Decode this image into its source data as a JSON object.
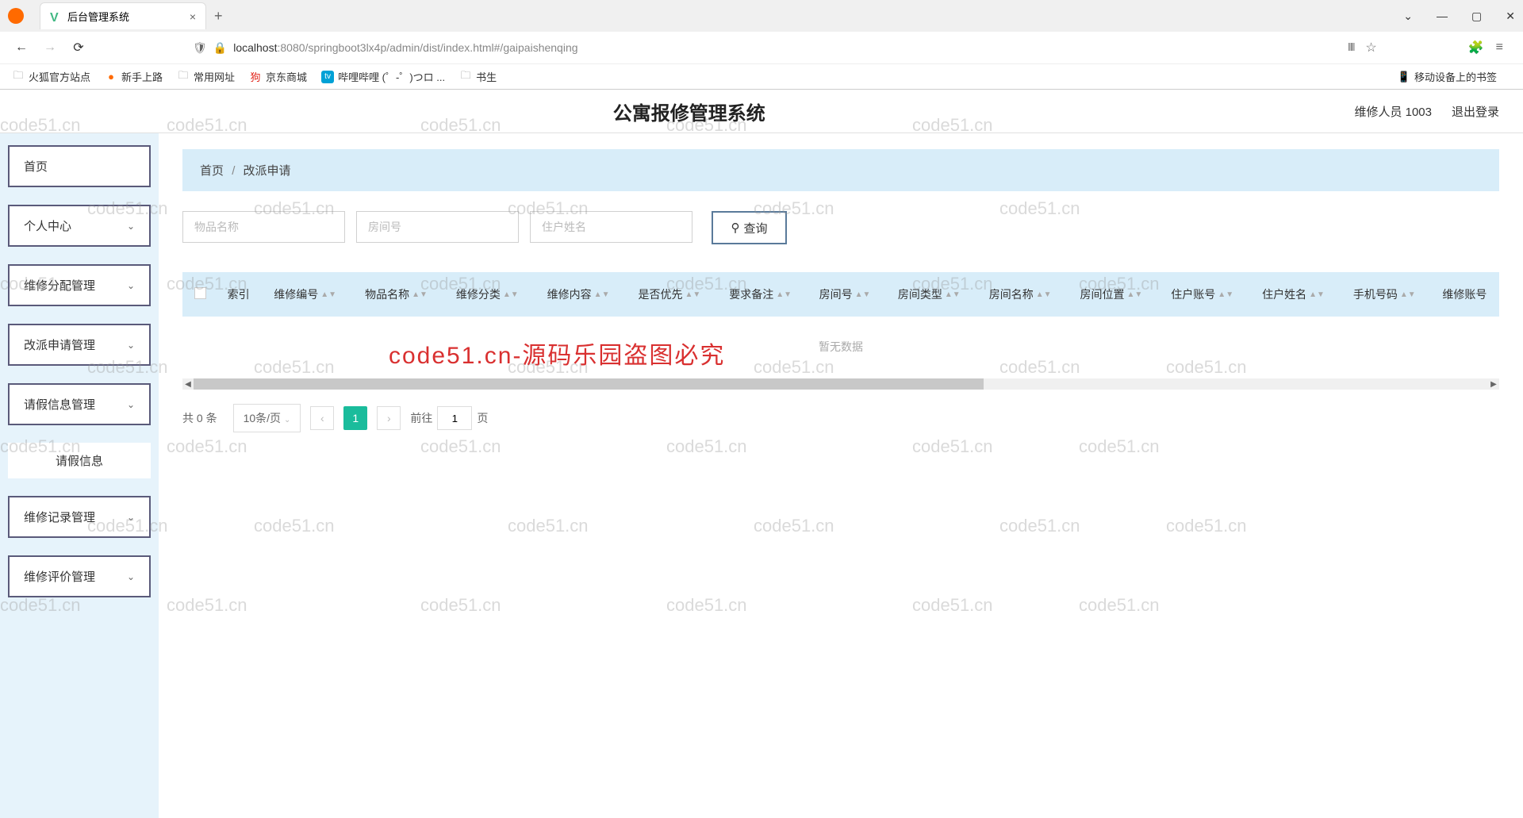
{
  "browser": {
    "tab_title": "后台管理系统",
    "url_host": "localhost",
    "url_path": ":8080/springboot3lx4p/admin/dist/index.html#/gaipaishenqing",
    "window_min": "—",
    "window_max": "▢",
    "window_close": "✕",
    "window_down": "⌄",
    "new_tab": "+",
    "tab_close": "×",
    "nav_back": "←",
    "nav_fwd": "→",
    "nav_reload": "⟳"
  },
  "bookmarks": {
    "b1": "火狐官方站点",
    "b2": "新手上路",
    "b3": "常用网址",
    "b4": "京东商城",
    "b5": "哔哩哔哩 (゜-゜)つロ ...",
    "b6": "书生",
    "right": "移动设备上的书签"
  },
  "header": {
    "title": "公寓报修管理系统",
    "user": "维修人员 1003",
    "logout": "退出登录"
  },
  "sidebar": {
    "m1": "首页",
    "m2": "个人中心",
    "m3": "维修分配管理",
    "m4": "改派申请管理",
    "m5": "请假信息管理",
    "m5_sub": "请假信息",
    "m6": "维修记录管理",
    "m7": "维修评价管理"
  },
  "breadcrumb": {
    "home": "首页",
    "sep": "/",
    "current": "改派申请"
  },
  "search": {
    "ph1": "物品名称",
    "ph2": "房间号",
    "ph3": "住户姓名",
    "btn": "查询"
  },
  "table": {
    "h1": "索引",
    "h2": "维修编号",
    "h3": "物品名称",
    "h4": "维修分类",
    "h5": "维修内容",
    "h6": "是否优先",
    "h7": "要求备注",
    "h8": "房间号",
    "h9": "房间类型",
    "h10": "房间名称",
    "h11": "房间位置",
    "h12": "住户账号",
    "h13": "住户姓名",
    "h14": "手机号码",
    "h15": "维修账号",
    "empty": "暂无数据"
  },
  "pagination": {
    "total": "共 0 条",
    "size": "10条/页",
    "current": "1",
    "jump_pre": "前往",
    "jump_val": "1",
    "jump_suf": "页",
    "prev": "‹",
    "next": "›"
  },
  "watermark": {
    "text": "code51.cn",
    "red": "code51.cn-源码乐园盗图必究"
  }
}
